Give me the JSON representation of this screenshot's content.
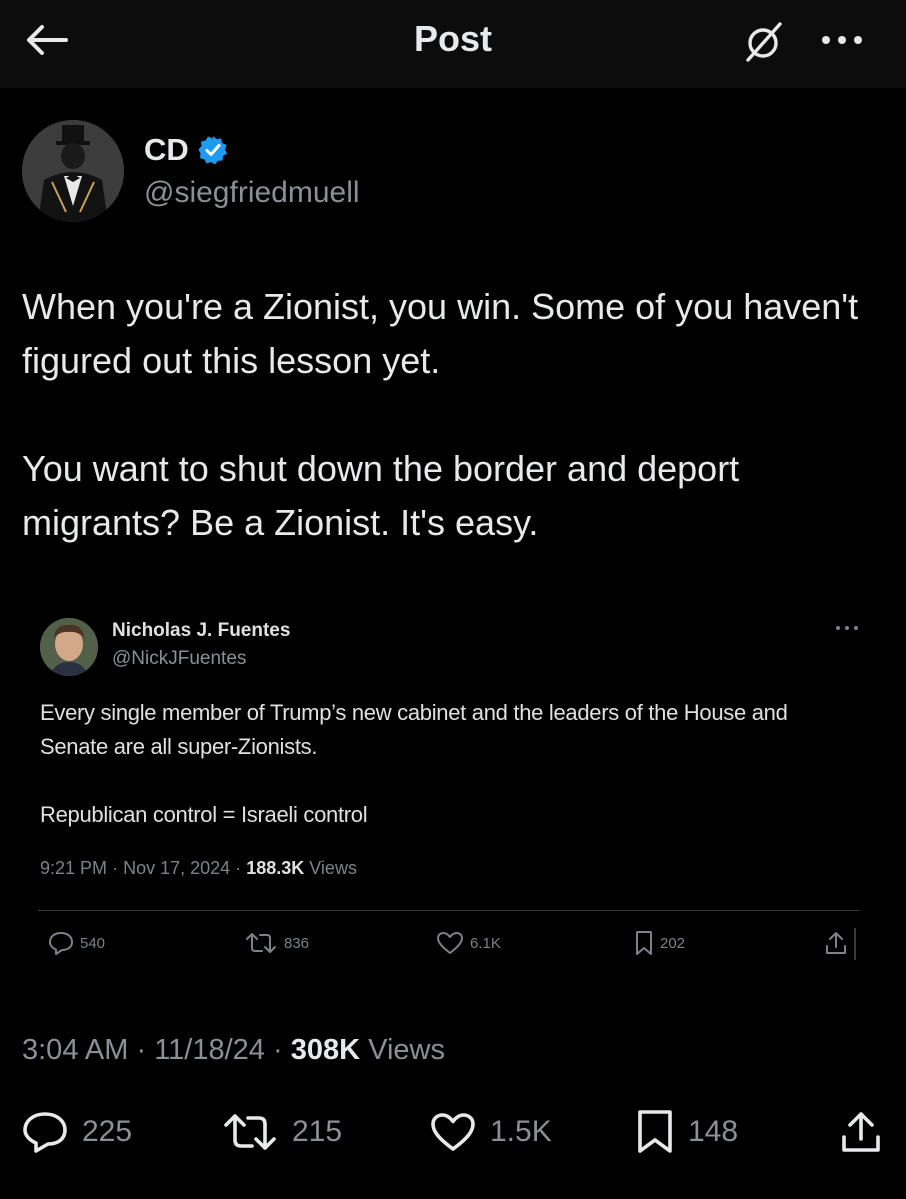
{
  "header": {
    "title": "Post"
  },
  "post": {
    "author_name": "CD",
    "author_handle": "@siegfriedmuell",
    "paragraphs": [
      "When you're a Zionist, you win.  Some of you haven't figured out this lesson yet.",
      "You want to shut down the border and deport migrants?  Be a Zionist.  It's easy."
    ],
    "time": "3:04 AM",
    "date": "11/18/24",
    "views_count": "308K",
    "views_label": "Views",
    "separator": "·",
    "replies": "225",
    "reposts": "215",
    "likes": "1.5K",
    "bookmarks": "148"
  },
  "quoted_post": {
    "author_name": "Nicholas J. Fuentes",
    "author_handle": "@NickJFuentes",
    "paragraphs": [
      "Every single member of Trump’s new cabinet and the leaders of the House and Senate are all super-Zionists.",
      "Republican control = Israeli control"
    ],
    "time": "9:21 PM",
    "date": "Nov 17, 2024",
    "views_count": "188.3K",
    "views_label": "Views",
    "separator": "·",
    "replies": "540",
    "reposts": "836",
    "likes": "6.1K",
    "bookmarks": "202"
  },
  "colors": {
    "background": "#000000",
    "header_background": "#0c0c0c",
    "text_primary": "#e7e9ea",
    "text_secondary": "#8b9096",
    "verified_badge": "#1d9bf0"
  },
  "icons": {
    "back": "arrow-left-icon",
    "grok": "grok-icon",
    "more": "more-dots-icon",
    "verified": "verified-badge-icon",
    "reply": "reply-icon",
    "repost": "repost-icon",
    "like": "heart-icon",
    "bookmark": "bookmark-icon",
    "share": "share-icon"
  }
}
